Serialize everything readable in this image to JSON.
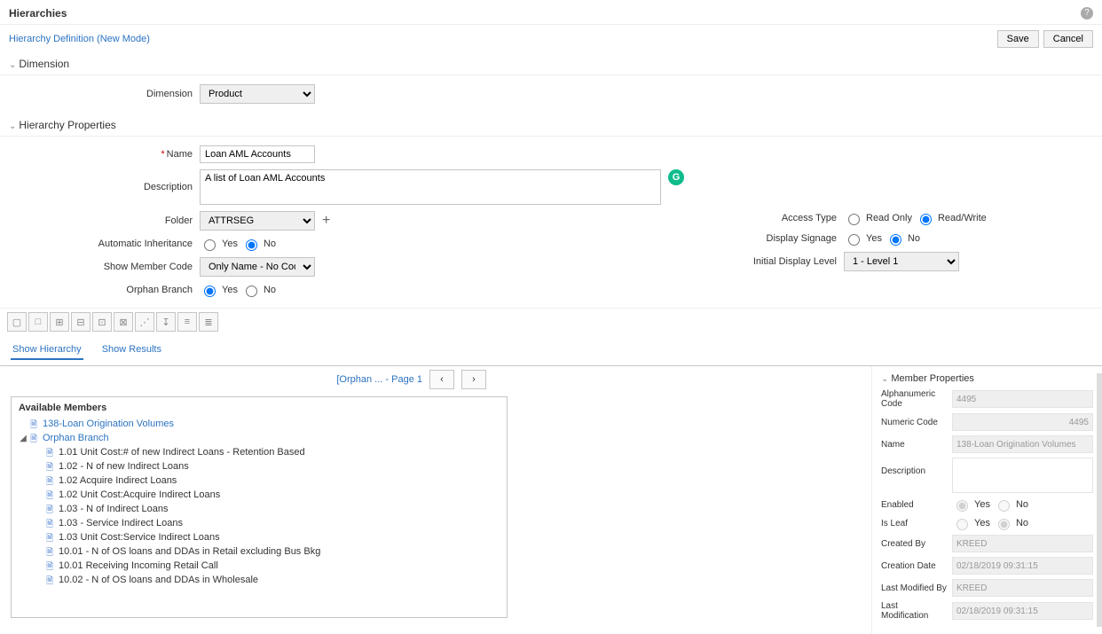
{
  "header": {
    "title": "Hierarchies",
    "help_tip": "?"
  },
  "subheader": {
    "link_text": "Hierarchy Definition (New Mode)",
    "save_label": "Save",
    "cancel_label": "Cancel"
  },
  "sections": {
    "dimension": {
      "header": "Dimension",
      "label": "Dimension",
      "value": "Product"
    },
    "hierarchy_properties": {
      "header": "Hierarchy Properties",
      "name_label": "Name",
      "name_value": "Loan AML Accounts",
      "description_label": "Description",
      "description_value": "A list of Loan AML Accounts",
      "folder_label": "Folder",
      "folder_value": "ATTRSEG",
      "auto_inherit_label": "Automatic Inheritance",
      "show_member_code_label": "Show Member Code",
      "show_member_code_value": "Only Name - No Code",
      "orphan_branch_label": "Orphan Branch",
      "access_type_label": "Access Type",
      "display_signage_label": "Display Signage",
      "initial_display_level_label": "Initial Display Level",
      "initial_display_level_value": "1 - Level 1",
      "yes_label": "Yes",
      "no_label": "No",
      "read_only_label": "Read Only",
      "read_write_label": "Read/Write"
    }
  },
  "tabs": {
    "show_hierarchy": "Show Hierarchy",
    "show_results": "Show Results"
  },
  "pager": {
    "crumb": "[Orphan ...  - Page 1",
    "prev": "‹",
    "next": "›"
  },
  "tree": {
    "title": "Available Members",
    "root1": "138-Loan Origination Volumes",
    "orphan_branch": "Orphan Branch",
    "children": [
      "1.01 Unit Cost:# of new Indirect Loans - Retention Based",
      "1.02 - N of new Indirect Loans",
      "1.02 Acquire Indirect Loans",
      "1.02 Unit Cost:Acquire Indirect Loans",
      "1.03 - N of Indirect Loans",
      "1.03 - Service Indirect Loans",
      "1.03 Unit Cost:Service Indirect Loans",
      "10.01 - N of OS loans and DDAs in Retail excluding Bus Bkg",
      "10.01 Receiving Incoming Retail Call",
      "10.02 - N of OS loans and DDAs in Wholesale"
    ]
  },
  "member_props": {
    "header": "Member Properties",
    "alpha_code_label": "Alphanumeric Code",
    "alpha_code_value": "4495",
    "numeric_code_label": "Numeric Code",
    "numeric_code_value": "4495",
    "name_label": "Name",
    "name_value": "138-Loan Origination Volumes",
    "description_label": "Description",
    "description_value": "",
    "enabled_label": "Enabled",
    "is_leaf_label": "Is Leaf",
    "created_by_label": "Created By",
    "created_by_value": "KREED",
    "creation_date_label": "Creation Date",
    "creation_date_value": "02/18/2019 09:31:15",
    "last_mod_by_label": "Last Modified By",
    "last_mod_by_value": "KREED",
    "last_mod_label": "Last Modification",
    "last_mod_value": "02/18/2019 09:31:15",
    "yes_label": "Yes",
    "no_label": "No"
  }
}
